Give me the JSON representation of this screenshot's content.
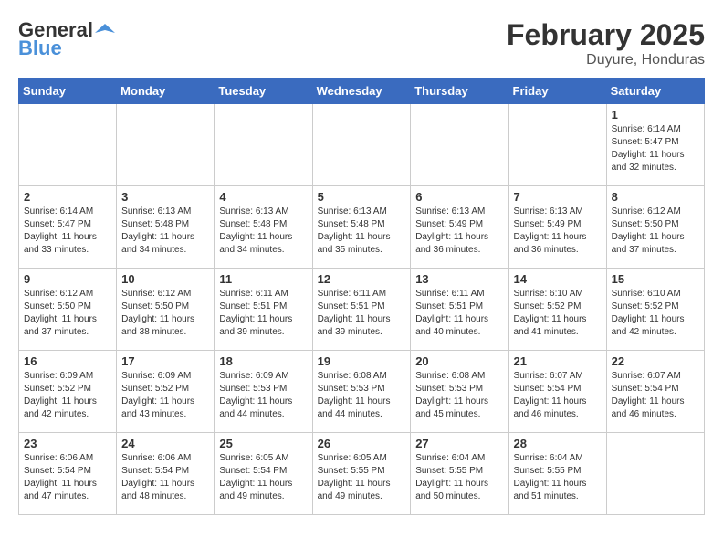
{
  "header": {
    "logo_general": "General",
    "logo_blue": "Blue",
    "title": "February 2025",
    "subtitle": "Duyure, Honduras"
  },
  "weekdays": [
    "Sunday",
    "Monday",
    "Tuesday",
    "Wednesday",
    "Thursday",
    "Friday",
    "Saturday"
  ],
  "weeks": [
    [
      {
        "day": "",
        "info": ""
      },
      {
        "day": "",
        "info": ""
      },
      {
        "day": "",
        "info": ""
      },
      {
        "day": "",
        "info": ""
      },
      {
        "day": "",
        "info": ""
      },
      {
        "day": "",
        "info": ""
      },
      {
        "day": "1",
        "info": "Sunrise: 6:14 AM\nSunset: 5:47 PM\nDaylight: 11 hours\nand 32 minutes."
      }
    ],
    [
      {
        "day": "2",
        "info": "Sunrise: 6:14 AM\nSunset: 5:47 PM\nDaylight: 11 hours\nand 33 minutes."
      },
      {
        "day": "3",
        "info": "Sunrise: 6:13 AM\nSunset: 5:48 PM\nDaylight: 11 hours\nand 34 minutes."
      },
      {
        "day": "4",
        "info": "Sunrise: 6:13 AM\nSunset: 5:48 PM\nDaylight: 11 hours\nand 34 minutes."
      },
      {
        "day": "5",
        "info": "Sunrise: 6:13 AM\nSunset: 5:48 PM\nDaylight: 11 hours\nand 35 minutes."
      },
      {
        "day": "6",
        "info": "Sunrise: 6:13 AM\nSunset: 5:49 PM\nDaylight: 11 hours\nand 36 minutes."
      },
      {
        "day": "7",
        "info": "Sunrise: 6:13 AM\nSunset: 5:49 PM\nDaylight: 11 hours\nand 36 minutes."
      },
      {
        "day": "8",
        "info": "Sunrise: 6:12 AM\nSunset: 5:50 PM\nDaylight: 11 hours\nand 37 minutes."
      }
    ],
    [
      {
        "day": "9",
        "info": "Sunrise: 6:12 AM\nSunset: 5:50 PM\nDaylight: 11 hours\nand 37 minutes."
      },
      {
        "day": "10",
        "info": "Sunrise: 6:12 AM\nSunset: 5:50 PM\nDaylight: 11 hours\nand 38 minutes."
      },
      {
        "day": "11",
        "info": "Sunrise: 6:11 AM\nSunset: 5:51 PM\nDaylight: 11 hours\nand 39 minutes."
      },
      {
        "day": "12",
        "info": "Sunrise: 6:11 AM\nSunset: 5:51 PM\nDaylight: 11 hours\nand 39 minutes."
      },
      {
        "day": "13",
        "info": "Sunrise: 6:11 AM\nSunset: 5:51 PM\nDaylight: 11 hours\nand 40 minutes."
      },
      {
        "day": "14",
        "info": "Sunrise: 6:10 AM\nSunset: 5:52 PM\nDaylight: 11 hours\nand 41 minutes."
      },
      {
        "day": "15",
        "info": "Sunrise: 6:10 AM\nSunset: 5:52 PM\nDaylight: 11 hours\nand 42 minutes."
      }
    ],
    [
      {
        "day": "16",
        "info": "Sunrise: 6:09 AM\nSunset: 5:52 PM\nDaylight: 11 hours\nand 42 minutes."
      },
      {
        "day": "17",
        "info": "Sunrise: 6:09 AM\nSunset: 5:52 PM\nDaylight: 11 hours\nand 43 minutes."
      },
      {
        "day": "18",
        "info": "Sunrise: 6:09 AM\nSunset: 5:53 PM\nDaylight: 11 hours\nand 44 minutes."
      },
      {
        "day": "19",
        "info": "Sunrise: 6:08 AM\nSunset: 5:53 PM\nDaylight: 11 hours\nand 44 minutes."
      },
      {
        "day": "20",
        "info": "Sunrise: 6:08 AM\nSunset: 5:53 PM\nDaylight: 11 hours\nand 45 minutes."
      },
      {
        "day": "21",
        "info": "Sunrise: 6:07 AM\nSunset: 5:54 PM\nDaylight: 11 hours\nand 46 minutes."
      },
      {
        "day": "22",
        "info": "Sunrise: 6:07 AM\nSunset: 5:54 PM\nDaylight: 11 hours\nand 46 minutes."
      }
    ],
    [
      {
        "day": "23",
        "info": "Sunrise: 6:06 AM\nSunset: 5:54 PM\nDaylight: 11 hours\nand 47 minutes."
      },
      {
        "day": "24",
        "info": "Sunrise: 6:06 AM\nSunset: 5:54 PM\nDaylight: 11 hours\nand 48 minutes."
      },
      {
        "day": "25",
        "info": "Sunrise: 6:05 AM\nSunset: 5:54 PM\nDaylight: 11 hours\nand 49 minutes."
      },
      {
        "day": "26",
        "info": "Sunrise: 6:05 AM\nSunset: 5:55 PM\nDaylight: 11 hours\nand 49 minutes."
      },
      {
        "day": "27",
        "info": "Sunrise: 6:04 AM\nSunset: 5:55 PM\nDaylight: 11 hours\nand 50 minutes."
      },
      {
        "day": "28",
        "info": "Sunrise: 6:04 AM\nSunset: 5:55 PM\nDaylight: 11 hours\nand 51 minutes."
      },
      {
        "day": "",
        "info": ""
      }
    ]
  ]
}
